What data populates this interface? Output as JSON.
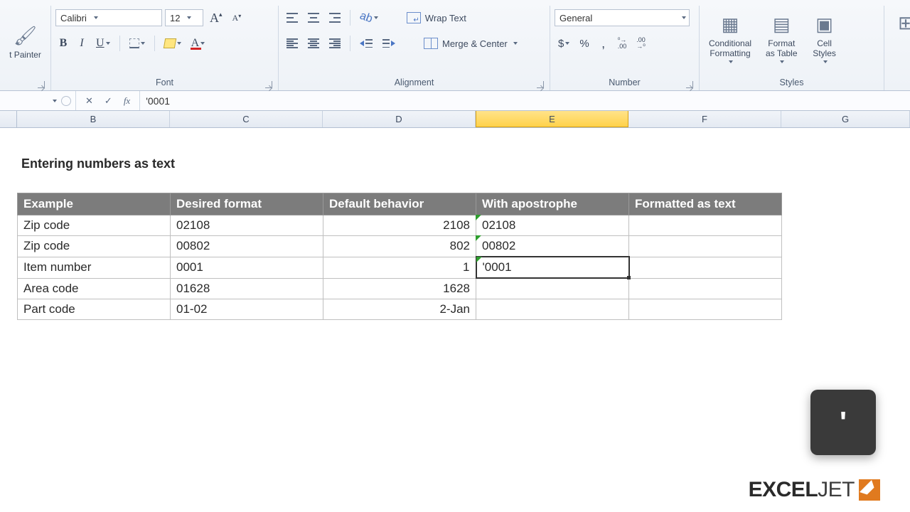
{
  "ribbon": {
    "clipboard": {
      "painter": "t Painter",
      "label": ""
    },
    "font": {
      "name": "Calibri",
      "size": "12",
      "bold": "B",
      "italic": "I",
      "underline": "U",
      "grow": "A",
      "shrink": "A",
      "fontcolor_letter": "A",
      "label": "Font"
    },
    "alignment": {
      "wrap": "Wrap Text",
      "merge": "Merge & Center",
      "label": "Alignment"
    },
    "number": {
      "format": "General",
      "currency": "$",
      "percent": "%",
      "comma": ",",
      "inc": ".0\n.00",
      "dec": ".00\n.0",
      "label": "Number"
    },
    "styles": {
      "conditional": "Conditional\nFormatting",
      "table": "Format\nas Table",
      "cell": "Cell\nStyles",
      "label": "Styles"
    }
  },
  "formula_bar": {
    "cancel": "✕",
    "enter": "✓",
    "fx": "fx",
    "value": "'0001"
  },
  "columns": [
    "B",
    "C",
    "D",
    "E",
    "F",
    "G"
  ],
  "sheet": {
    "title": "Entering numbers as text",
    "headers": [
      "Example",
      "Desired format",
      "Default behavior",
      "With apostrophe",
      "Formatted as text"
    ],
    "rows": [
      {
        "ex": "Zip code",
        "df": "02108",
        "db": "2108",
        "wa": "02108",
        "ft": ""
      },
      {
        "ex": "Zip code",
        "df": "00802",
        "db": "802",
        "wa": "00802",
        "ft": ""
      },
      {
        "ex": "Item number",
        "df": "0001",
        "db": "1",
        "wa": "'0001",
        "ft": ""
      },
      {
        "ex": "Area code",
        "df": "01628",
        "db": "1628",
        "wa": "",
        "ft": ""
      },
      {
        "ex": "Part code",
        "df": "01-02",
        "db": "2-Jan",
        "wa": "",
        "ft": ""
      }
    ]
  },
  "key_popup": "'",
  "logo": {
    "a": "EXCEL",
    "b": "JET"
  }
}
